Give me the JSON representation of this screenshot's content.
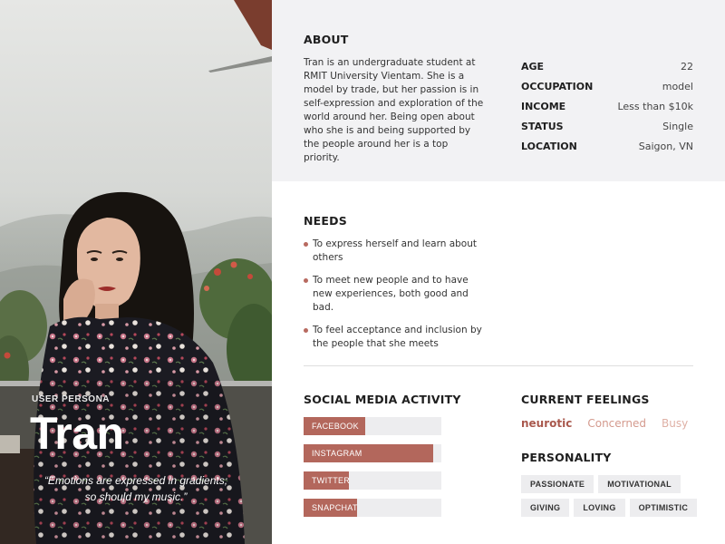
{
  "persona": {
    "label": "USER PERSONA",
    "name": "Tran",
    "quote_line1": "“Emotions are expressed in gradients;",
    "quote_line2": "so should my music.”"
  },
  "about": {
    "title": "ABOUT",
    "text": "Tran is an undergraduate student at RMIT University Vientam.  She is a model by trade, but her passion is in self-expression and exploration of the world around her. Being open about who she is and being supported by the people around her is a top priority."
  },
  "info": [
    {
      "key": "AGE",
      "value": "22"
    },
    {
      "key": "OCCUPATION",
      "value": "model"
    },
    {
      "key": "INCOME",
      "value": "Less than $10k"
    },
    {
      "key": "STATUS",
      "value": "Single"
    },
    {
      "key": "LOCATION",
      "value": "Saigon, VN"
    }
  ],
  "needs": {
    "title": "NEEDS",
    "items": [
      "To express herself and learn about others",
      "To meet new people and to have new experiences, both good and bad.",
      "To feel acceptance and inclusion by the people that she meets"
    ]
  },
  "social": {
    "title": "SOCIAL MEDIA ACTIVITY",
    "items": [
      {
        "label": "FACEBOOK",
        "level": 0.45
      },
      {
        "label": "INSTAGRAM",
        "level": 0.94
      },
      {
        "label": "TWITTER",
        "level": 0.33
      },
      {
        "label": "SNAPCHAT",
        "level": 0.39
      }
    ]
  },
  "feelings": {
    "title": "CURRENT FEELINGS",
    "items": [
      {
        "label": "neurotic",
        "color": "#a9584d",
        "weight": "bold"
      },
      {
        "label": "Concerned",
        "color": "#d49a8e",
        "weight": "normal"
      },
      {
        "label": "Busy",
        "color": "#dfb0a5",
        "weight": "normal"
      }
    ]
  },
  "personality": {
    "title": "PERSONALITY",
    "row1": [
      "PASSIONATE",
      "MOTIVATIONAL"
    ],
    "row2": [
      "GIVING",
      "LOVING",
      "OPTIMISTIC"
    ]
  },
  "colors": {
    "accent": "#b3675c",
    "about_bg": "#f2f2f4",
    "pill_bg": "#ededef"
  }
}
